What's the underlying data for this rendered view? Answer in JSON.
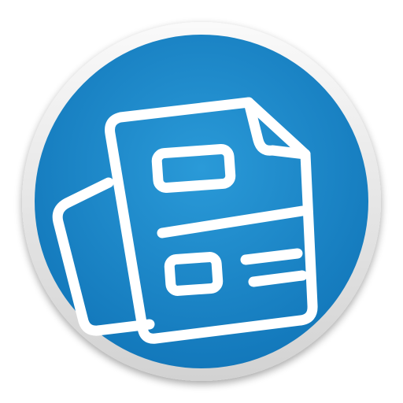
{
  "icon": {
    "name": "document-pages-icon",
    "colors": {
      "background": "#ffffff",
      "ring_light": "#fafafa",
      "ring_dark": "#d2d2d2",
      "disc_center": "#2a9ad8",
      "disc_edge": "#1277ba",
      "glyph": "#ffffff"
    }
  }
}
